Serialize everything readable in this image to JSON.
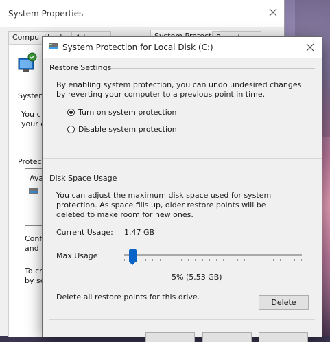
{
  "back_window": {
    "title": "System Properties",
    "tabs": [
      "Computer Name",
      "Hardware",
      "Advanced",
      "System Protection",
      "Remote"
    ],
    "active_tab": "System Protection",
    "fragments": {
      "system": "System",
      "you_c": "You c",
      "your_c": "your c",
      "protection": "Protection",
      "ava": "Ava",
      "config": "Config",
      "and_d": "and d",
      "to_cr": "To cr",
      "by_se": "by se"
    },
    "close_icon": "close-icon"
  },
  "dialog": {
    "title": "System Protection for Local Disk (C:)",
    "icon": "drive-icon",
    "restore_settings": {
      "header": "Restore Settings",
      "description": "By enabling system protection, you can undo undesired changes by reverting your computer to a previous point in time.",
      "options": [
        {
          "label": "Turn on system protection",
          "checked": true
        },
        {
          "label": "Disable system protection",
          "checked": false
        }
      ]
    },
    "disk_space": {
      "header": "Disk Space Usage",
      "description": "You can adjust the maximum disk space used for system protection. As space fills up, older restore points will be deleted to make room for new ones.",
      "current_usage_label": "Current Usage:",
      "current_usage_value": "1.47 GB",
      "max_usage_label": "Max Usage:",
      "max_usage_fraction": 0.05,
      "max_usage_value": "5% (5.53 GB)"
    },
    "delete_text": "Delete all restore points for this drive.",
    "delete_button": "Delete",
    "accent_color": "#0a64c8"
  }
}
